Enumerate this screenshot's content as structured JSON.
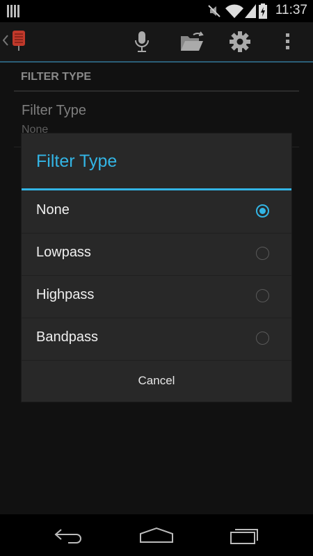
{
  "status_bar": {
    "time": "11:37"
  },
  "action_bar": {
    "icons": [
      "back-icon",
      "app-icon",
      "microphone-icon",
      "folder-open-icon",
      "gear-icon",
      "overflow-menu-icon"
    ]
  },
  "settings": {
    "section_header": "FILTER TYPE",
    "pref_title": "Filter Type",
    "pref_summary": "None"
  },
  "dialog": {
    "title": "Filter Type",
    "options": [
      {
        "label": "None",
        "checked": true
      },
      {
        "label": "Lowpass",
        "checked": false
      },
      {
        "label": "Highpass",
        "checked": false
      },
      {
        "label": "Bandpass",
        "checked": false
      }
    ],
    "cancel_label": "Cancel"
  },
  "nav_bar": {
    "icons": [
      "back-nav-icon",
      "home-nav-icon",
      "recents-nav-icon"
    ]
  },
  "colors": {
    "accent": "#33b5e5",
    "dialog_bg": "#282828"
  }
}
